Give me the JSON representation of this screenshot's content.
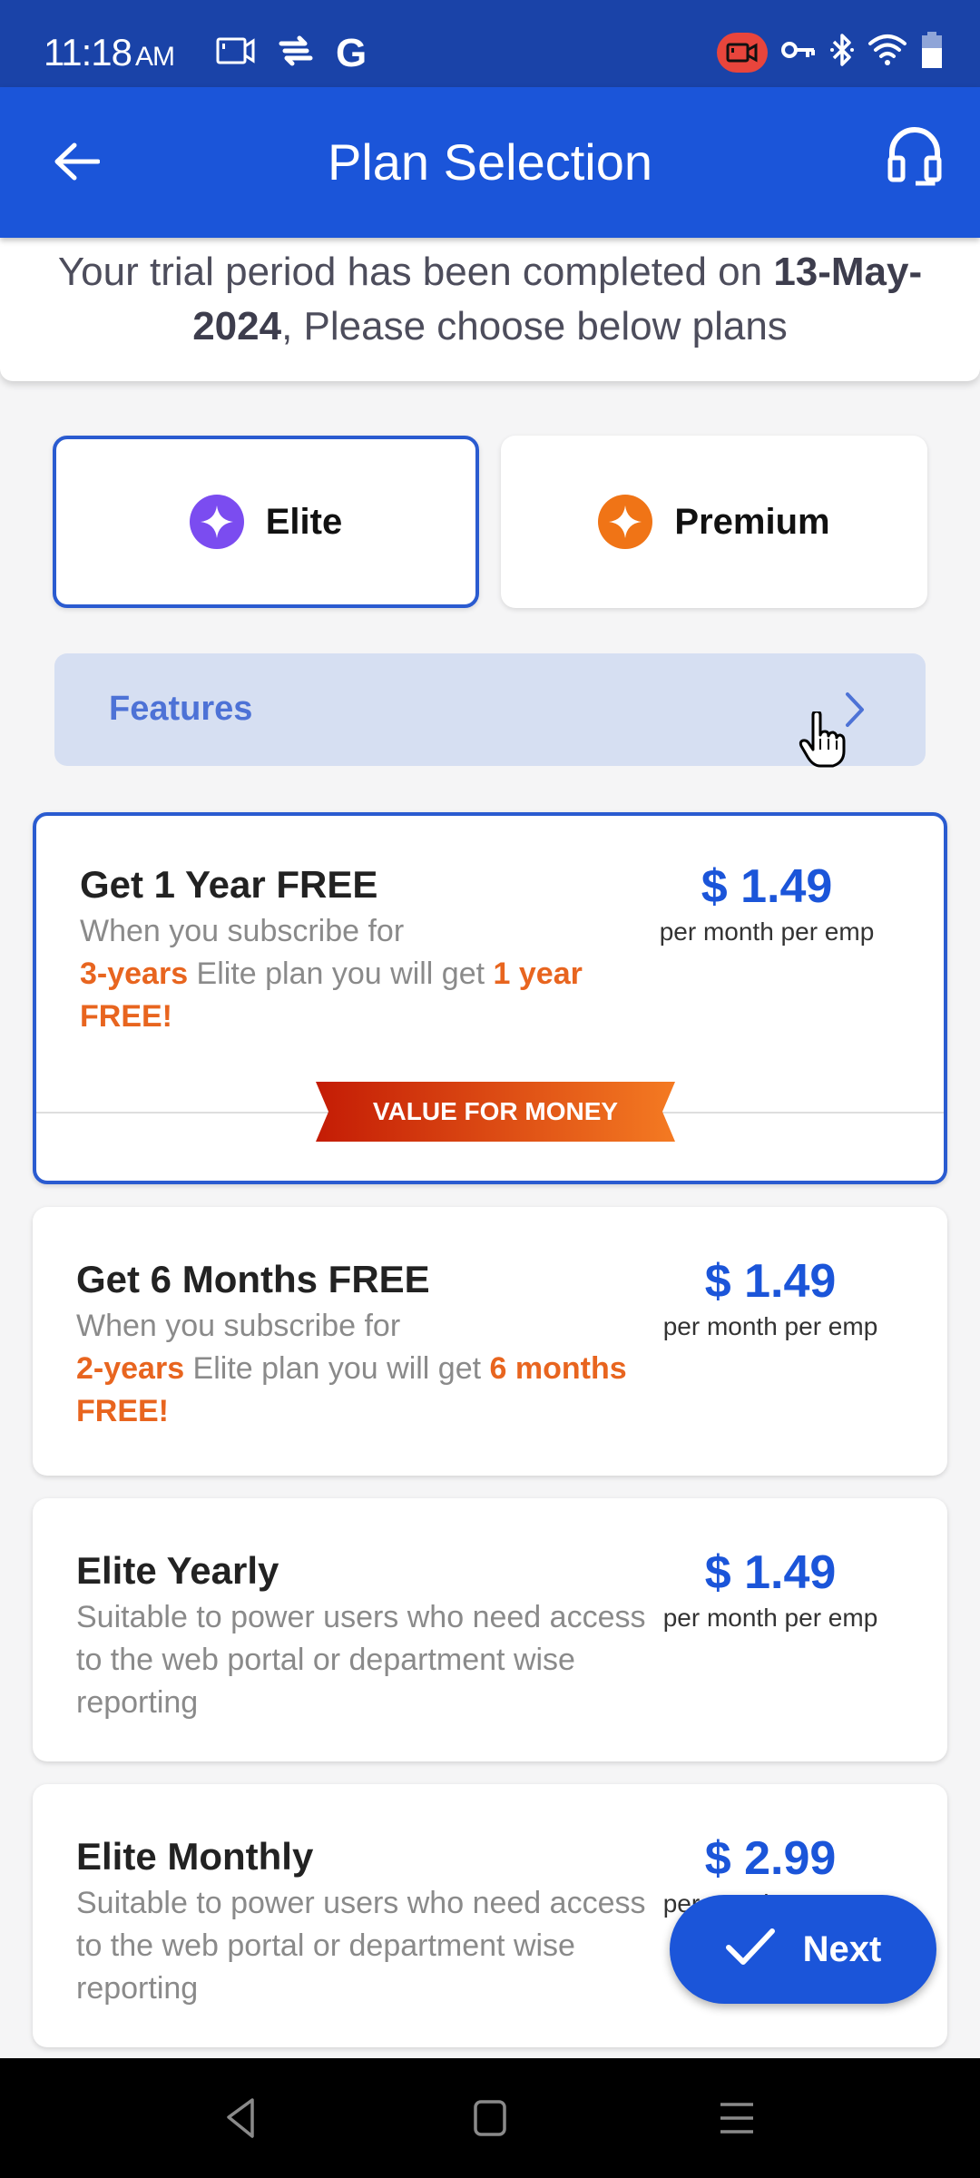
{
  "status_bar": {
    "time": "11:18",
    "ampm": "AM",
    "left_icons": [
      "screen-record-icon",
      "sync-icon",
      "google-icon"
    ],
    "google_glyph": "G",
    "right_icons": [
      "recording-badge-icon",
      "vpn-key-icon",
      "bluetooth-icon",
      "wifi-icon",
      "battery-icon"
    ]
  },
  "app_bar": {
    "title": "Plan Selection",
    "back_icon": "arrow-left-icon",
    "support_icon": "headset-icon"
  },
  "trial_banner": {
    "prefix": "Your trial period has been completed on ",
    "date": "13-May-2024",
    "suffix": ", Please choose below plans"
  },
  "plan_tabs": [
    {
      "label": "Elite",
      "icon": "sparkle-icon",
      "color": "#7b4cf0",
      "selected": true
    },
    {
      "label": "Premium",
      "icon": "sparkle-icon",
      "color": "#f07416",
      "selected": false
    }
  ],
  "features": {
    "label": "Features",
    "icon": "chevron-right-icon"
  },
  "plans": [
    {
      "title": "Get 1 Year FREE",
      "desc_parts": [
        "When you subscribe for ",
        "3-years",
        " Elite plan you will get  ",
        "1 year FREE!"
      ],
      "price": "$ 1.49",
      "unit": "per month per emp",
      "badge": "VALUE FOR MONEY",
      "selected": true
    },
    {
      "title": "Get 6 Months FREE",
      "desc_parts": [
        "When you subscribe for ",
        "2-years",
        " Elite plan you will get ",
        "6 months FREE!"
      ],
      "price": "$ 1.49",
      "unit": "per month per emp",
      "selected": false
    },
    {
      "title": "Elite Yearly",
      "desc": "Suitable to power users who need access to the web portal or department wise reporting",
      "price": "$ 1.49",
      "unit": "per month per emp",
      "selected": false
    },
    {
      "title": "Elite Monthly",
      "desc": "Suitable to power users who need access to the web portal or department wise reporting",
      "price": "$ 2.99",
      "unit": "per month per emp",
      "selected": false
    }
  ],
  "next_button": {
    "label": "Next",
    "icon": "check-icon"
  },
  "nav_bar": {
    "buttons": [
      "back-nav-icon",
      "home-nav-icon",
      "recents-nav-icon"
    ]
  },
  "colors": {
    "primary": "#1b55d9",
    "status_bar": "#1a43a8",
    "highlight": "#e8651f",
    "features_bg": "#d6dff2"
  }
}
